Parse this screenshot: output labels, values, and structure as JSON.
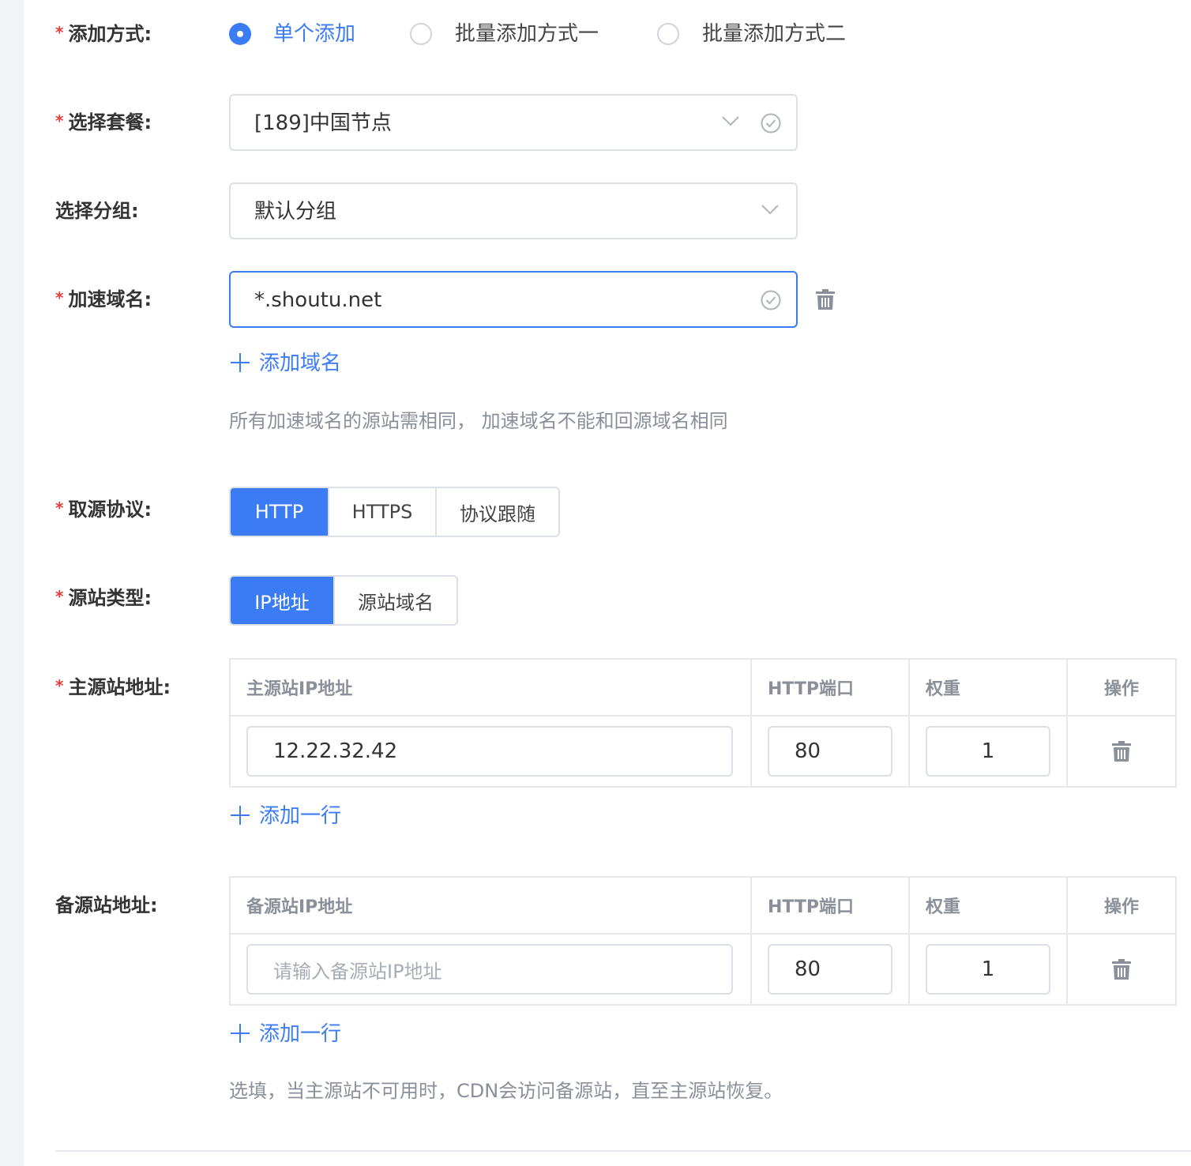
{
  "form": {
    "add_mode": {
      "label": "添加方式:",
      "options": [
        {
          "label": "单个添加",
          "checked": true
        },
        {
          "label": "批量添加方式一",
          "checked": false
        },
        {
          "label": "批量添加方式二",
          "checked": false
        }
      ]
    },
    "package": {
      "label": "选择套餐:",
      "value": "[189]中国节点"
    },
    "group": {
      "label": "选择分组:",
      "value": "默认分组"
    },
    "domain": {
      "label": "加速域名:",
      "value": "*.shoutu.net",
      "add_link": "添加域名",
      "hint": "所有加速域名的源站需相同， 加速域名不能和回源域名相同"
    },
    "protocol": {
      "label": "取源协议:",
      "options": [
        "HTTP",
        "HTTPS",
        "协议跟随"
      ],
      "selected": "HTTP"
    },
    "origin_type": {
      "label": "源站类型:",
      "options": [
        "IP地址",
        "源站域名"
      ],
      "selected": "IP地址"
    },
    "primary": {
      "label": "主源站地址:",
      "headers": [
        "主源站IP地址",
        "HTTP端口",
        "权重",
        "操作"
      ],
      "rows": [
        {
          "ip": "12.22.32.42",
          "port": "80",
          "weight": "1"
        }
      ],
      "add_link": "添加一行"
    },
    "backup": {
      "label": "备源站地址:",
      "headers": [
        "备源站IP地址",
        "HTTP端口",
        "权重",
        "操作"
      ],
      "rows": [
        {
          "ip_placeholder": "请输入备源站IP地址",
          "port": "80",
          "weight": "1"
        }
      ],
      "add_link": "添加一行",
      "hint": "选填，当主源站不可用时，CDN会访问备源站，直至主源站恢复。"
    }
  },
  "colors": {
    "accent": "#3b7cf4",
    "required": "#e63b3b",
    "hint": "#8a8f99"
  }
}
